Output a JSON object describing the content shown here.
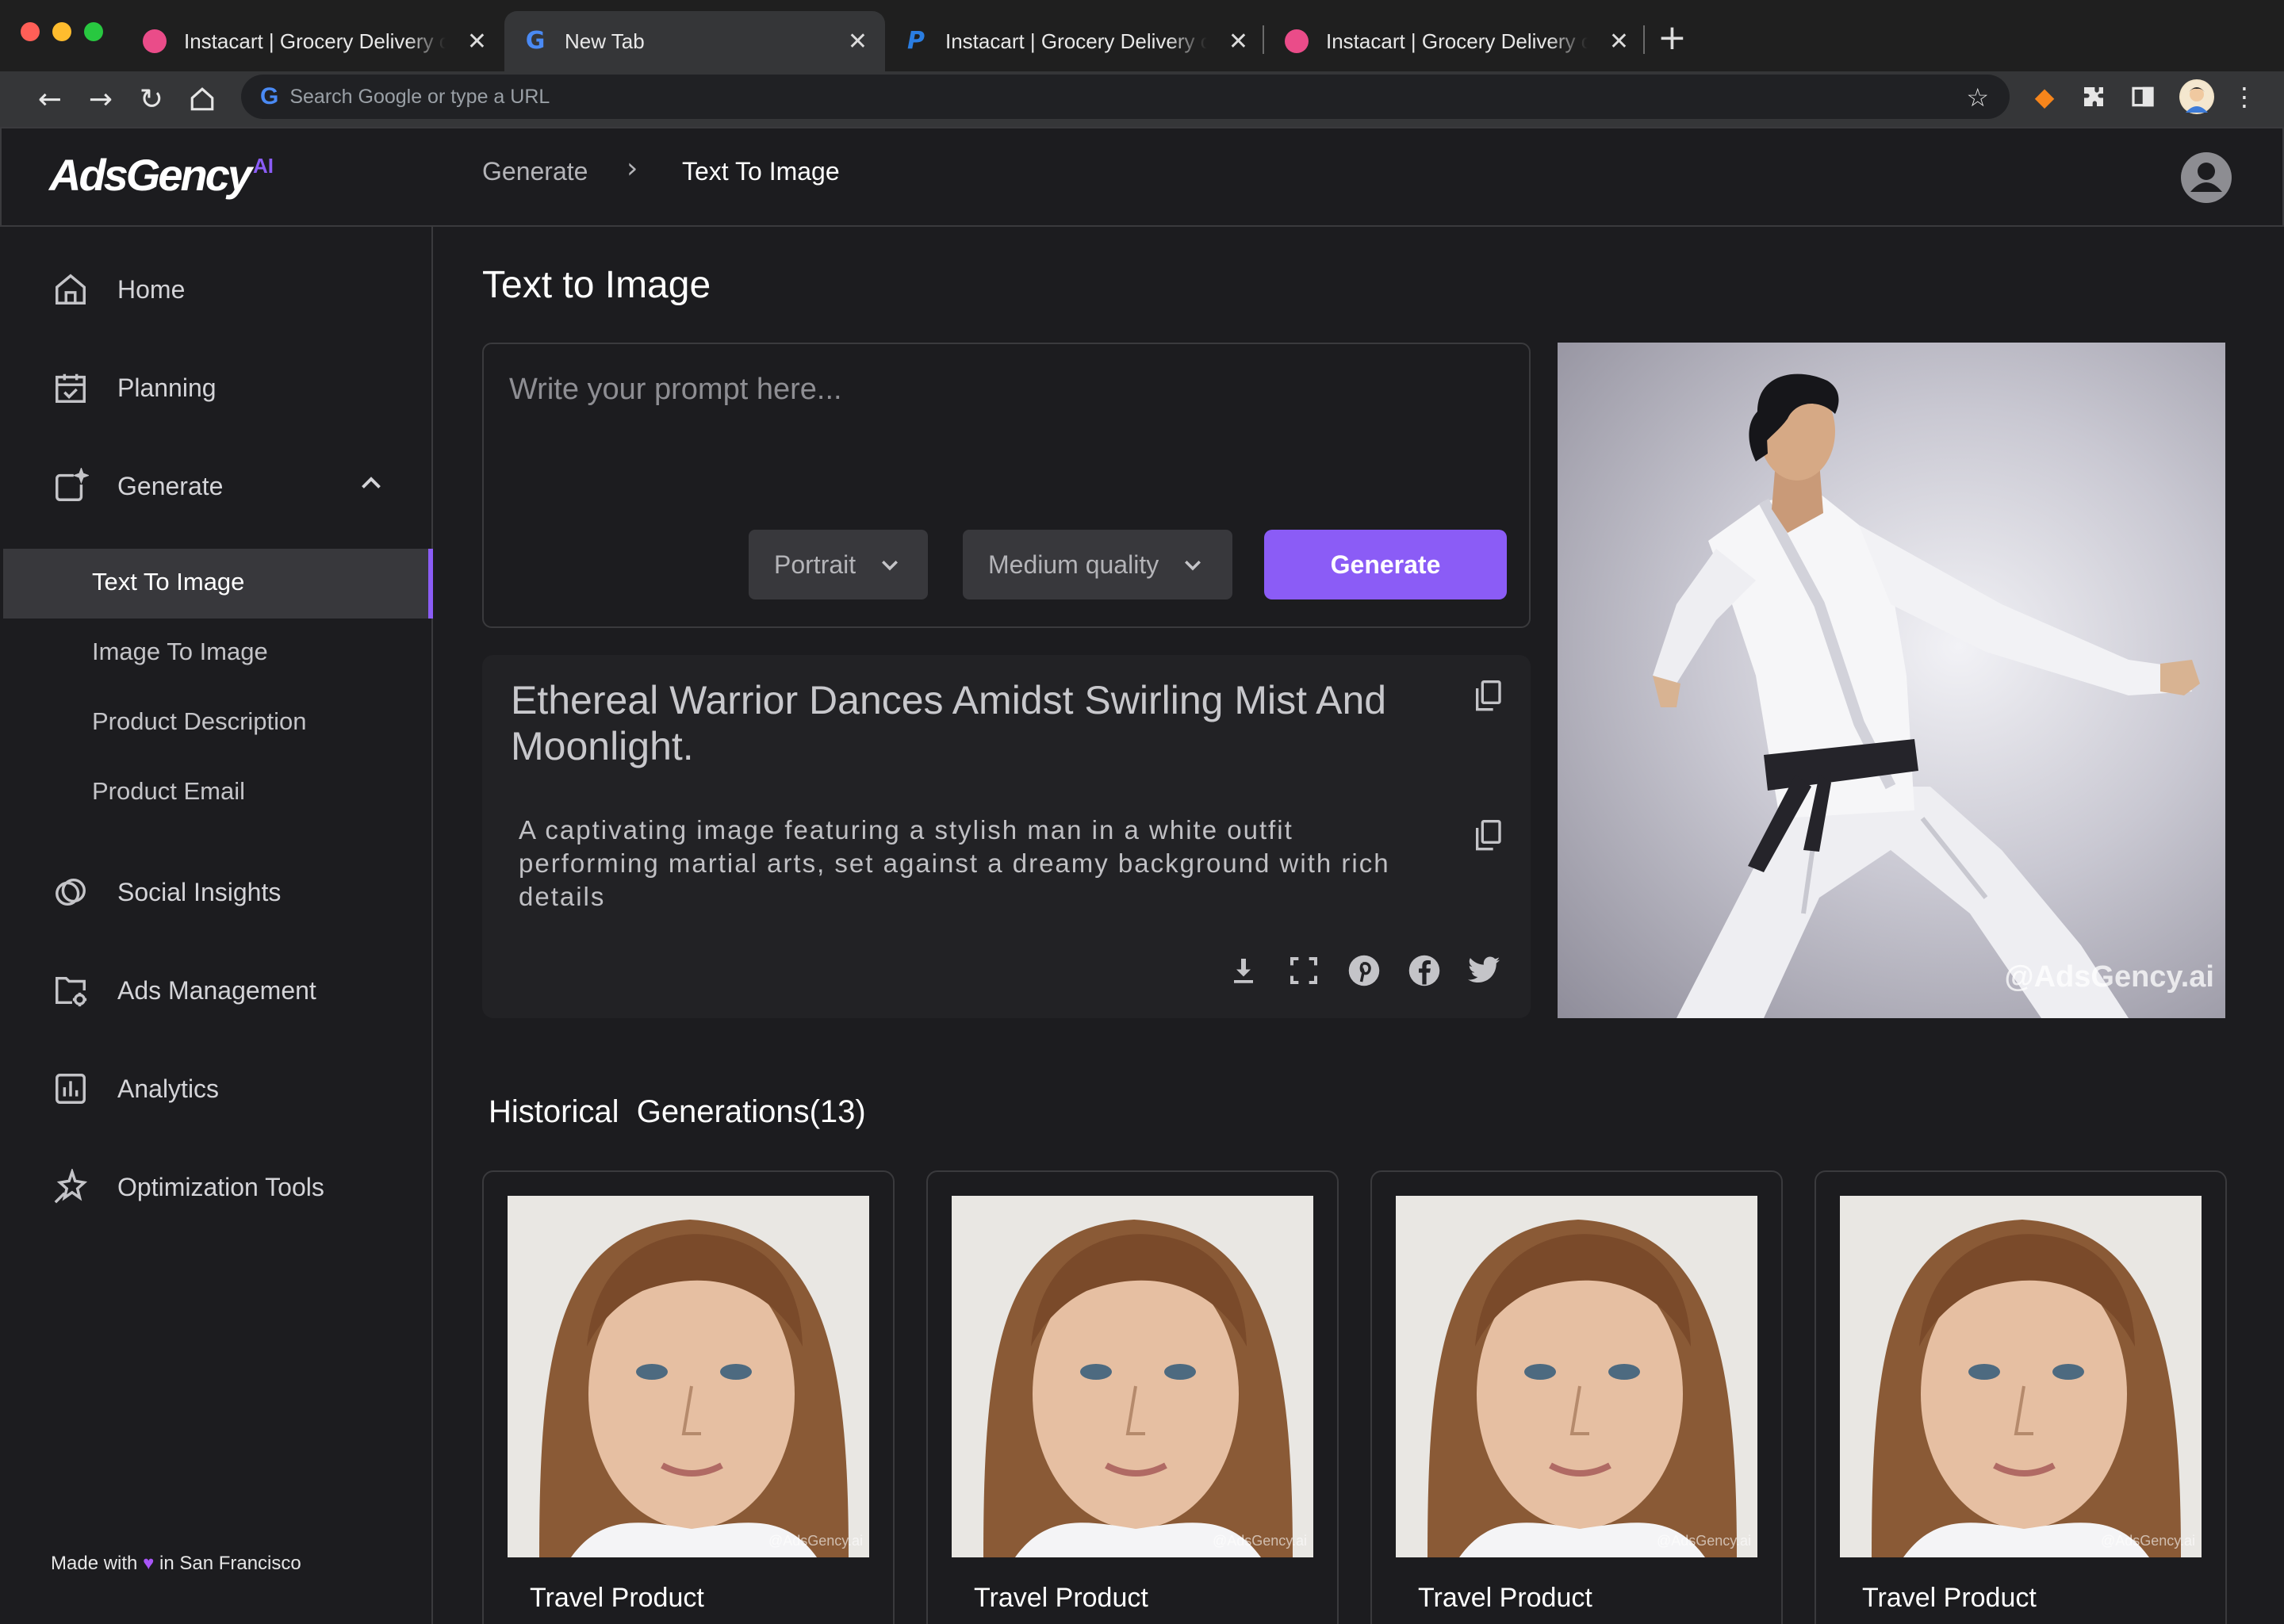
{
  "browser": {
    "tabs": [
      {
        "title": "Instacart | Grocery Delivery or Pickup",
        "favicon": "dribbble-icon",
        "active": false
      },
      {
        "title": "New Tab",
        "favicon": "google-icon",
        "active": true
      },
      {
        "title": "Instacart | Grocery Delivery or Pickup",
        "favicon": "paypal-icon",
        "active": false
      },
      {
        "title": "Instacart | Grocery Delivery or Pickup",
        "favicon": "dribbble-icon",
        "active": false
      }
    ],
    "omnibox_placeholder": "Search Google or type a URL",
    "colors": {
      "close": "#ff5f57",
      "minimize": "#febc2e",
      "zoom": "#28c840"
    }
  },
  "header": {
    "logo_text": "AdsGency",
    "logo_suffix": "AI",
    "breadcrumb": [
      "Generate",
      "Text To Image"
    ]
  },
  "sidebar": {
    "items": [
      {
        "label": "Home",
        "icon": "home-icon"
      },
      {
        "label": "Planning",
        "icon": "calendar-check-icon"
      },
      {
        "label": "Generate",
        "icon": "image-sparkle-icon",
        "expanded": true
      },
      {
        "label": "Social Insights",
        "icon": "social-rings-icon"
      },
      {
        "label": "Ads Management",
        "icon": "folder-gear-icon"
      },
      {
        "label": "Analytics",
        "icon": "bar-chart-icon"
      },
      {
        "label": "Optimization Tools",
        "icon": "magic-star-icon"
      }
    ],
    "sub_items": [
      "Text To Image",
      "Image To Image",
      "Product Description",
      "Product Email"
    ],
    "active_sub": "Text To Image",
    "footer": {
      "pre": "Made with",
      "post": "in San Francisco"
    }
  },
  "main": {
    "title": "Text to Image",
    "prompt_placeholder": "Write your prompt here...",
    "orientation": "Portrait",
    "quality": "Medium quality",
    "generate_label": "Generate",
    "result": {
      "title": "Ethereal Warrior Dances Amidst Swirling Mist And Moonlight.",
      "description": "A captivating image featuring a stylish man in a white outfit performing martial arts, set against a dreamy background with rich details",
      "image_watermark": "@AdsGency.ai",
      "actions": [
        "download-icon",
        "fullscreen-icon",
        "pinterest-icon",
        "facebook-icon",
        "twitter-icon"
      ]
    },
    "history": {
      "title": "Historical  Generations(13)",
      "cards": [
        {
          "label": "Travel Product",
          "watermark": "@AdsGency.ai"
        },
        {
          "label": "Travel Product",
          "watermark": "@AdsGency.ai"
        },
        {
          "label": "Travel Product",
          "watermark": "@AdsGency.ai"
        },
        {
          "label": "Travel Product",
          "watermark": "@AdsGency.ai"
        }
      ]
    },
    "accent_color": "#8b5cf6"
  }
}
